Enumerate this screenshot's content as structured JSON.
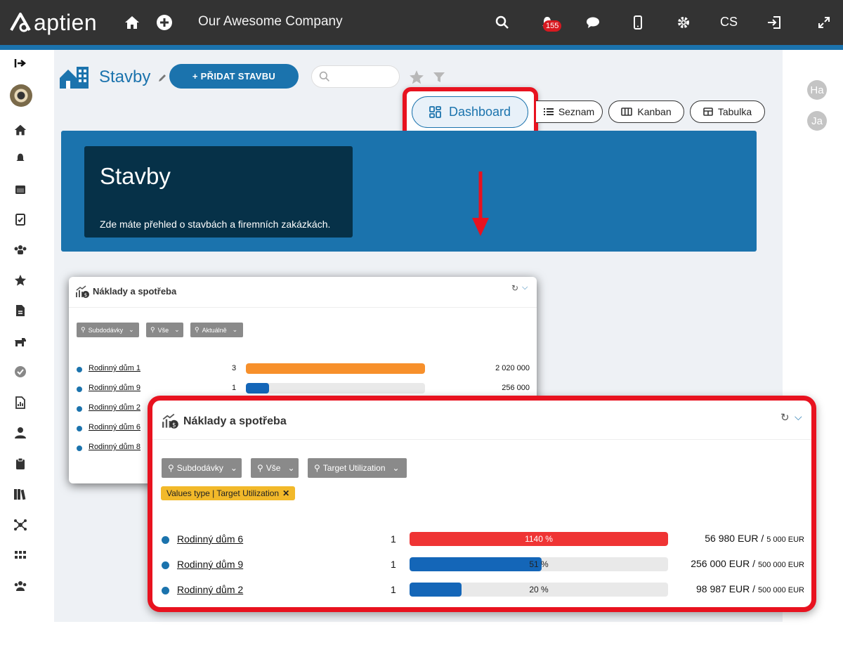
{
  "app": {
    "brand": "aptien",
    "company": "Our Awesome Company",
    "notifications": "155",
    "language": "CS"
  },
  "page": {
    "title": "Stavby",
    "add_button": "+ PŘIDAT STAVBU"
  },
  "views": {
    "dashboard": "Dashboard",
    "list": "Seznam",
    "kanban": "Kanban",
    "table": "Tabulka"
  },
  "hero": {
    "title": "Stavby",
    "subtitle": "Zde máte přehled o stavbách a firemních zakázkách."
  },
  "users": [
    "Ha",
    "Ja"
  ],
  "widget_small": {
    "title": "Náklady a spotřeba",
    "filters": [
      "Subdodávky",
      "Vše",
      "Aktuálně"
    ],
    "rows": [
      {
        "label": "Rodinný dům 1",
        "count": "3",
        "value": "2 020 000",
        "fill": 1.0,
        "color": "#f7902b"
      },
      {
        "label": "Rodinný dům 9",
        "count": "1",
        "value": "256 000",
        "fill": 0.13,
        "color": "#1466b8"
      },
      {
        "label": "Rodinný dům 2",
        "count": "",
        "value": "",
        "fill": 0,
        "color": "#1466b8"
      },
      {
        "label": "Rodinný dům 6",
        "count": "",
        "value": "",
        "fill": 0,
        "color": "#1466b8"
      },
      {
        "label": "Rodinný dům 8",
        "count": "",
        "value": "",
        "fill": 0,
        "color": "#1466b8"
      }
    ]
  },
  "widget_big": {
    "title": "Náklady a spotřeba",
    "filters": [
      "Subdodávky",
      "Vše",
      "Target Utilization"
    ],
    "active_tag": "Values type | Target Utilization",
    "rows": [
      {
        "label": "Rodinný dům 6",
        "count": "1",
        "percent_text": "1140 %",
        "fill": 1.0,
        "color": "#ef3434",
        "value": "56 980 EUR",
        "target": "5 000 EUR"
      },
      {
        "label": "Rodinný dům 9",
        "count": "1",
        "percent_text": "51 %",
        "fill": 0.51,
        "color": "#1466b8",
        "value": "256 000 EUR",
        "target": "500 000 EUR"
      },
      {
        "label": "Rodinný dům 2",
        "count": "1",
        "percent_text": "20 %",
        "fill": 0.2,
        "color": "#1466b8",
        "value": "98 987 EUR",
        "target": "500 000 EUR"
      }
    ]
  }
}
